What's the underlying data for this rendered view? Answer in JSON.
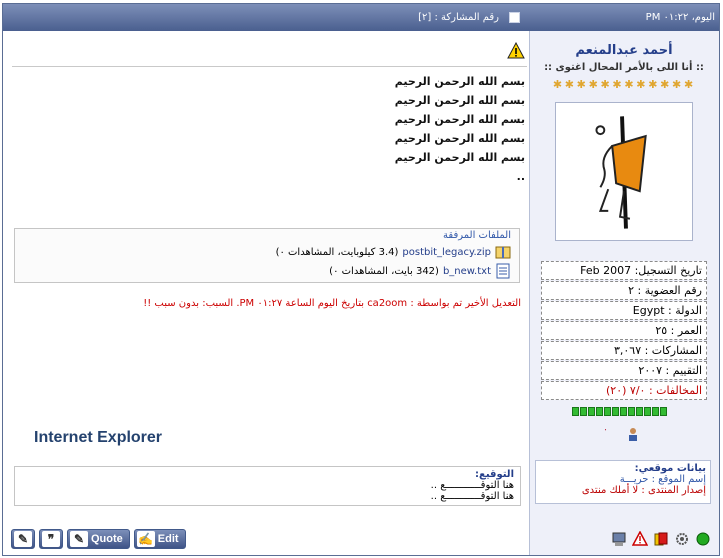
{
  "header": {
    "post_number": "رقم المشاركة : [٢]",
    "date": "اليوم، ٠١:٢٢ PM"
  },
  "user": {
    "name": "أحمد عبدالمنعم",
    "title": ":: أنا اللى بالأمر المحال اغتوى ::",
    "star_count": 12,
    "info": [
      "تاريخ التسجيل: Feb 2007",
      "رقم العضوية : ٢",
      "الدولة : Egypt",
      "العمر : ٢٥",
      "المشاركات : ٣,٠٦٧",
      "التقييم : ٢٠٠٧",
      "المخالفات : ٧/٠ (٢٠)"
    ],
    "rep_bars": 12,
    "location": {
      "heading": "بيانات موقعي:",
      "site_name": "إسم الموقع : حريـــة",
      "forum_version": "إصدار المنتدى : لا أملك منتدى"
    }
  },
  "post": {
    "lines": [
      "بسم الله الرحمن الرحيم",
      "بسم الله الرحمن الرحيم",
      "بسم الله الرحمن الرحيم",
      "بسم الله الرحمن الرحيم",
      "بسم الله الرحمن الرحيم",
      ".."
    ],
    "attachments_heading": "الملفات المرفقة",
    "attachments": [
      {
        "name": "postbit_legacy.zip",
        "info": "(3.4 كيلوبايت، المشاهدات ٠)"
      },
      {
        "name": "b_new.txt",
        "info": "(342 بايت، المشاهدات ٠)"
      }
    ],
    "edit_note": "التعديل الأخير تم بواسطة : ca2oom بتاريخ اليوم الساعة ٠١:٢٧ PM. السبب: بدون سبب !!",
    "ie_label": "Internet Explorer",
    "signature_heading": "التوقيع:",
    "signature_lines": [
      "هنا التوقــــــــــــع ..",
      "هنا التوقــــــــــــع .."
    ]
  },
  "buttons": {
    "quote": "Quote",
    "edit": "Edit"
  },
  "colors": {
    "header_gradient_top": "#7d8fb8",
    "header_gradient_bottom": "#4a5f8f",
    "sidebar_bg": "#eef0f9",
    "name_color": "#243e8a",
    "warning_red": "#c00"
  }
}
